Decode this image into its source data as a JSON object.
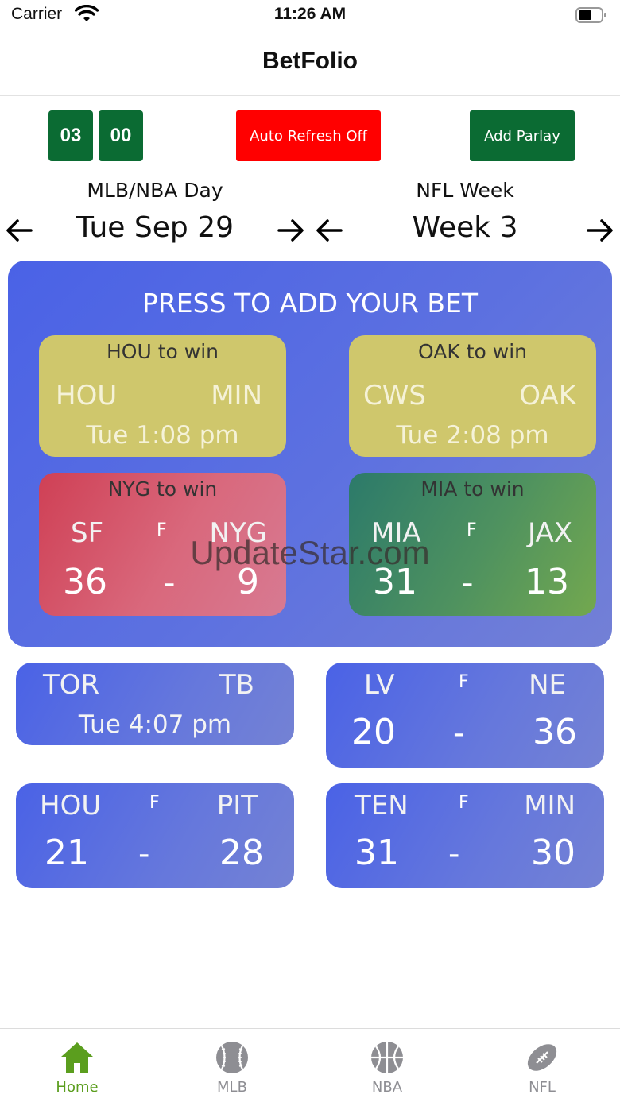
{
  "status_bar": {
    "carrier": "Carrier",
    "time": "11:26 AM"
  },
  "nav": {
    "title": "BetFolio"
  },
  "timer": {
    "minutes": "03",
    "seconds": "00"
  },
  "buttons": {
    "auto_refresh": "Auto Refresh Off",
    "add_parlay": "Add Parlay"
  },
  "mlb_nba": {
    "label": "MLB/NBA Day",
    "value": "Tue Sep 29"
  },
  "nfl": {
    "label": "NFL Week",
    "value": "Week 3"
  },
  "panel": {
    "title": "PRESS TO ADD YOUR BET"
  },
  "bets": [
    {
      "header": "HOU to win",
      "away": "HOU",
      "home": "MIN",
      "time": "Tue 1:08 pm"
    },
    {
      "header": "OAK to win",
      "away": "CWS",
      "home": "OAK",
      "time": "Tue 2:08 pm"
    },
    {
      "header": "NYG to win",
      "away": "SF",
      "home": "NYG",
      "status": "F",
      "away_score": "36",
      "dash": "-",
      "home_score": "9"
    },
    {
      "header": "MIA to win",
      "away": "MIA",
      "home": "JAX",
      "status": "F",
      "away_score": "31",
      "dash": "-",
      "home_score": "13"
    }
  ],
  "games": [
    {
      "away": "TOR",
      "home": "TB",
      "time": "Tue 4:07 pm"
    },
    {
      "away": "LV",
      "home": "NE",
      "status": "F",
      "away_score": "20",
      "dash": "-",
      "home_score": "36"
    },
    {
      "away": "HOU",
      "home": "PIT",
      "status": "F",
      "away_score": "21",
      "dash": "-",
      "home_score": "28"
    },
    {
      "away": "TEN",
      "home": "MIN",
      "status": "F",
      "away_score": "31",
      "dash": "-",
      "home_score": "30"
    }
  ],
  "watermark": "UpdateStar.com",
  "tabs": [
    {
      "label": "Home",
      "icon": "home-icon",
      "active": true
    },
    {
      "label": "MLB",
      "icon": "baseball-icon"
    },
    {
      "label": "NBA",
      "icon": "basketball-icon"
    },
    {
      "label": "NFL",
      "icon": "football-icon"
    }
  ],
  "colors": {
    "dark_green": "#0b6b33",
    "red": "#ff0000",
    "panel_blue": "#4a62e6",
    "bet_yellow": "#cfc76c",
    "active_tab": "#5b9e1e",
    "inactive_tab": "#8e8e93"
  }
}
